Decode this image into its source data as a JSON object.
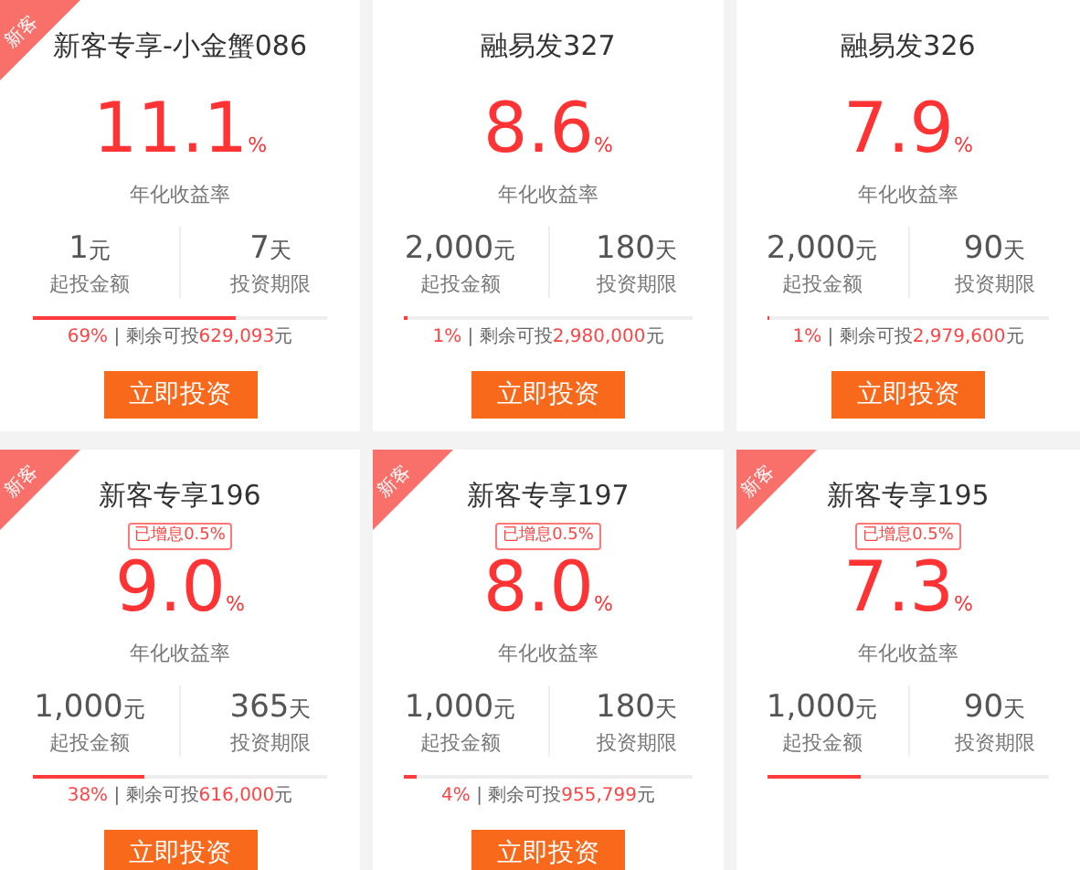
{
  "cards": [
    {
      "tag": "新客",
      "title": "新客专享-小金蟹086",
      "rate": "11.1",
      "rate_unit": "%",
      "rate_label": "年化收益率",
      "min_amount": "1",
      "min_unit": "元",
      "min_label": "起投金额",
      "term": "7",
      "term_unit": "天",
      "term_label": "投资期限",
      "level": 0.69,
      "remaining": {
        "percent": "69%",
        "separator": "|",
        "label": "剩余可投",
        "amount": "629,093",
        "unit": "元"
      },
      "button": "立即投资"
    },
    {
      "title": "融易发327",
      "rate": "8.6",
      "rate_unit": "%",
      "rate_label": "年化收益率",
      "min_amount": "2,000",
      "min_unit": "元",
      "min_label": "起投金额",
      "term": "180",
      "term_unit": "天",
      "term_label": "投资期限",
      "level": 0.01,
      "remaining": {
        "percent": "1%",
        "separator": "|",
        "label": "剩余可投",
        "amount": "2,980,000",
        "unit": "元"
      },
      "button": "立即投资"
    },
    {
      "title": "融易发326",
      "rate": "7.9",
      "rate_unit": "%",
      "rate_label": "年化收益率",
      "min_amount": "2,000",
      "min_unit": "元",
      "min_label": "起投金额",
      "term": "90",
      "term_unit": "天",
      "term_label": "投资期限",
      "level": 0.01,
      "remaining": {
        "percent": "1%",
        "separator": "|",
        "label": "剩余可投",
        "amount": "2,979,600",
        "unit": "元"
      },
      "button": "立即投资"
    },
    {
      "tag": "新客",
      "title": "新客专享196",
      "bonus": "已增息0.5%",
      "rate": "9.0",
      "rate_unit": "%",
      "rate_label": "年化收益率",
      "min_amount": "1,000",
      "min_unit": "元",
      "min_label": "起投金额",
      "term": "365",
      "term_unit": "天",
      "term_label": "投资期限",
      "level": 0.38,
      "remaining": {
        "percent": "38%",
        "separator": "|",
        "label": "剩余可投",
        "amount": "616,000",
        "unit": "元"
      },
      "button": "立即投资"
    },
    {
      "tag": "新客",
      "title": "新客专享197",
      "bonus": "已增息0.5%",
      "rate": "8.0",
      "rate_unit": "%",
      "rate_label": "年化收益率",
      "min_amount": "1,000",
      "min_unit": "元",
      "min_label": "起投金额",
      "term": "180",
      "term_unit": "天",
      "term_label": "投资期限",
      "level": 0.04,
      "remaining": {
        "percent": "4%",
        "separator": "|",
        "label": "剩余可投",
        "amount": "955,799",
        "unit": "元"
      },
      "button": "立即投资"
    },
    {
      "tag": "新客",
      "title": "新客专享195",
      "bonus": "已增息0.5%",
      "rate": "7.3",
      "rate_unit": "%",
      "rate_label": "年化收益率",
      "min_amount": "1,000",
      "min_unit": "元",
      "min_label": "起投金额",
      "term": "90",
      "term_unit": "天",
      "term_label": "投资期限",
      "level": 0.33
    }
  ]
}
